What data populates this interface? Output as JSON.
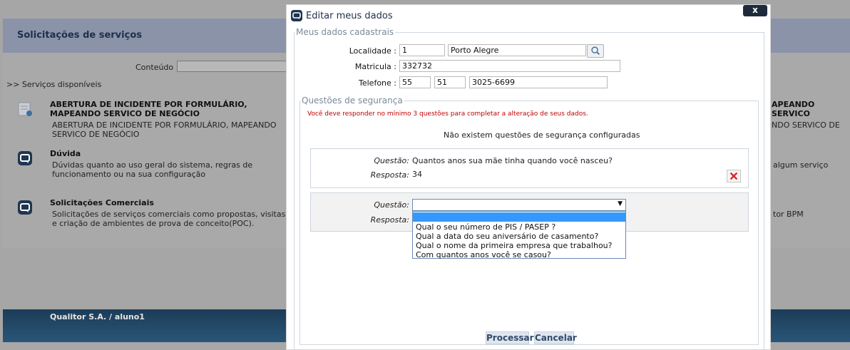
{
  "background": {
    "header_title": "Solicitações de serviços",
    "content_label": "Conteúdo :",
    "available_label": ">> Serviços disponíveis",
    "services": [
      {
        "title": "ABERTURA DE INCIDENTE POR FORMULÁRIO, MAPEANDO SERVICO DE NEGÓCIO",
        "description": "ABERTURA DE INCIDENTE POR FORMULÁRIO, MAPEANDO SERVICO DE NEGÓCIO"
      },
      {
        "title": "Dúvida",
        "description": "Dúvidas quanto ao uso geral do sistema, regras de funcionamento ou na sua configuração"
      },
      {
        "title": "Solicitações Comerciais",
        "description": "Solicitações de serviços comerciais como propostas, visitas e criação de ambientes de prova de conceito(POC)."
      }
    ],
    "right_fragments": {
      "title": "APEANDO SERVICO",
      "line1": "NDO SERVICO DE",
      "line2": "algum serviço",
      "line3": "tor BPM"
    },
    "footer_text": "Qualitor S.A. / aluno1"
  },
  "dialog": {
    "title": "Editar meus dados",
    "close_label": "x",
    "personal_legend": "Meus dados cadastrais",
    "locality_label": "Localidade :",
    "locality_code": "1",
    "locality_name": "Porto Alegre",
    "registration_label": "Matricula :",
    "registration_value": "332732",
    "phone_label": "Telefone :",
    "phone_country": "55",
    "phone_area": "51",
    "phone_number": "3025-6699",
    "security_legend": "Questões de segurança",
    "warning": "Você deve responder no mínimo 3 questões para completar a alteração de seus dados.",
    "no_questions": "Não existem questões de segurança configuradas",
    "question_label": "Questão:",
    "answer_label": "Resposta:",
    "question1_text": "Quantos anos sua mãe tinha quando você nasceu?",
    "answer1_text": "34",
    "question2_selected": "",
    "question2_options": [
      "",
      "Qual o seu número de PIS / PASEP ?",
      "Qual a data do seu aniversário de casamento?",
      "Qual o nome da primeira empresa que trabalhou?",
      "Com quantos anos você se casou?"
    ],
    "process_label": "Processar",
    "cancel_label": "Cancelar"
  }
}
